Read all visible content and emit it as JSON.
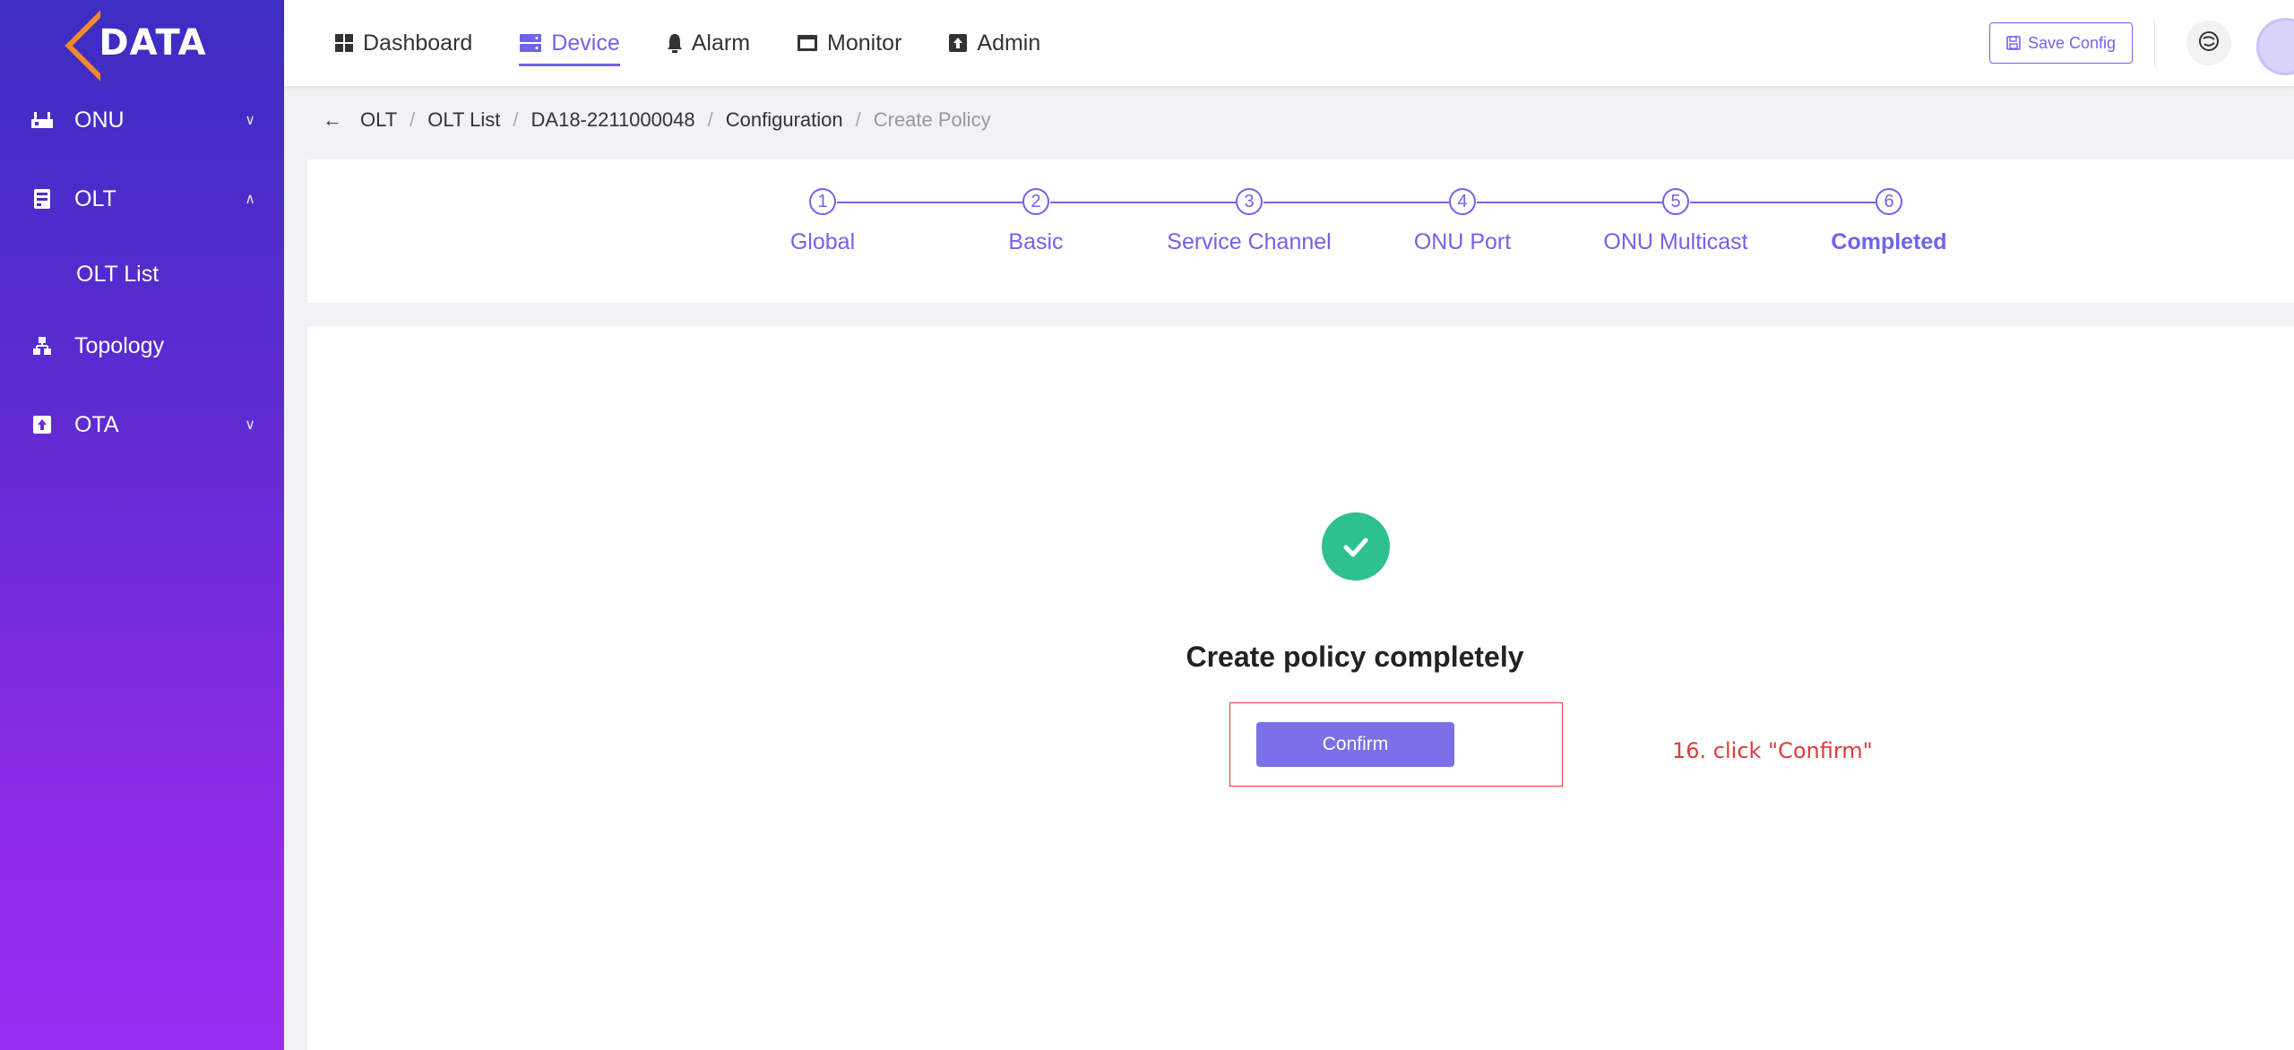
{
  "logo": {
    "text": "DATA"
  },
  "sidebar": {
    "items": [
      {
        "label": "ONU",
        "icon": "onu-icon",
        "expanded": false
      },
      {
        "label": "OLT",
        "icon": "olt-icon",
        "expanded": true,
        "children": [
          {
            "label": "OLT List"
          }
        ]
      },
      {
        "label": "Topology",
        "icon": "topology-icon"
      },
      {
        "label": "OTA",
        "icon": "ota-icon",
        "expanded": false
      }
    ]
  },
  "topnav": {
    "tabs": [
      {
        "label": "Dashboard",
        "icon": "dashboard-icon"
      },
      {
        "label": "Device",
        "icon": "device-icon",
        "active": true
      },
      {
        "label": "Alarm",
        "icon": "alarm-icon"
      },
      {
        "label": "Monitor",
        "icon": "monitor-icon"
      },
      {
        "label": "Admin",
        "icon": "admin-icon"
      }
    ],
    "save_label": "Save Config"
  },
  "breadcrumb": {
    "items": [
      "OLT",
      "OLT List",
      "DA18-2211000048",
      "Configuration"
    ],
    "current": "Create Policy"
  },
  "steps": [
    {
      "num": "1",
      "label": "Global"
    },
    {
      "num": "2",
      "label": "Basic"
    },
    {
      "num": "3",
      "label": "Service Channel"
    },
    {
      "num": "4",
      "label": "ONU Port"
    },
    {
      "num": "5",
      "label": "ONU Multicast"
    },
    {
      "num": "6",
      "label": "Completed",
      "current": true
    }
  ],
  "result": {
    "title": "Create policy completely",
    "confirm_label": "Confirm",
    "annotation": "16. click \"Confirm\""
  },
  "colors": {
    "accent": "#6f64ea",
    "success": "#2ec08f",
    "annotation": "#e03a3a",
    "logo_orange": "#f08a2a"
  }
}
